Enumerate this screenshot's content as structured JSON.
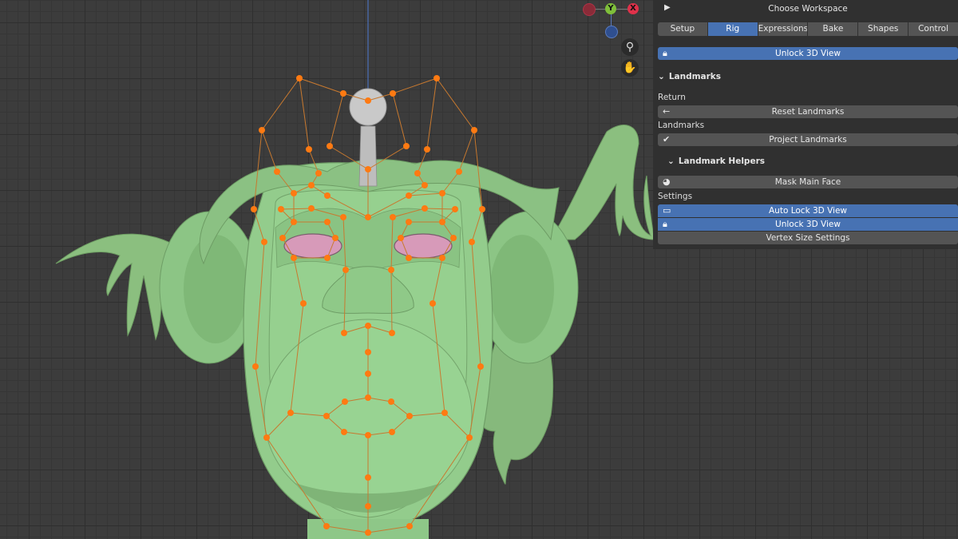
{
  "panel": {
    "choose_workspace": "Choose Workspace",
    "tabs": [
      {
        "label": "Setup"
      },
      {
        "label": "Rig"
      },
      {
        "label": "Expressions"
      },
      {
        "label": "Bake"
      },
      {
        "label": "Shapes"
      },
      {
        "label": "Control"
      }
    ],
    "active_tab": "Rig",
    "unlock_top": "Unlock 3D View",
    "landmarks_section": "Landmarks",
    "return_label": "Return",
    "reset_landmarks": "Reset Landmarks",
    "landmarks_label": "Landmarks",
    "project_landmarks": "Project Landmarks",
    "helpers_section": "Landmark Helpers",
    "mask_main_face": "Mask Main Face",
    "settings_label": "Settings",
    "auto_lock": "Auto Lock 3D View",
    "unlock_bottom": "Unlock 3D View",
    "vertex_size": "Vertex Size Settings"
  },
  "gizmo": {
    "y_label": "Y",
    "x_label": "X"
  },
  "colors": {
    "accent": "#4772b3",
    "landmark": "#ff7a12",
    "mesh": "#8fc98a",
    "eye": "#d98fb6",
    "axis_y": "#8bc34a",
    "axis_x": "#e0314a"
  },
  "icons": [
    "play-triangle-icon",
    "lock-icon",
    "chevron-down-icon",
    "back-arrow-icon",
    "checkmark-icon",
    "mask-icon",
    "monitor-icon",
    "zoom-icon",
    "hand-icon"
  ]
}
